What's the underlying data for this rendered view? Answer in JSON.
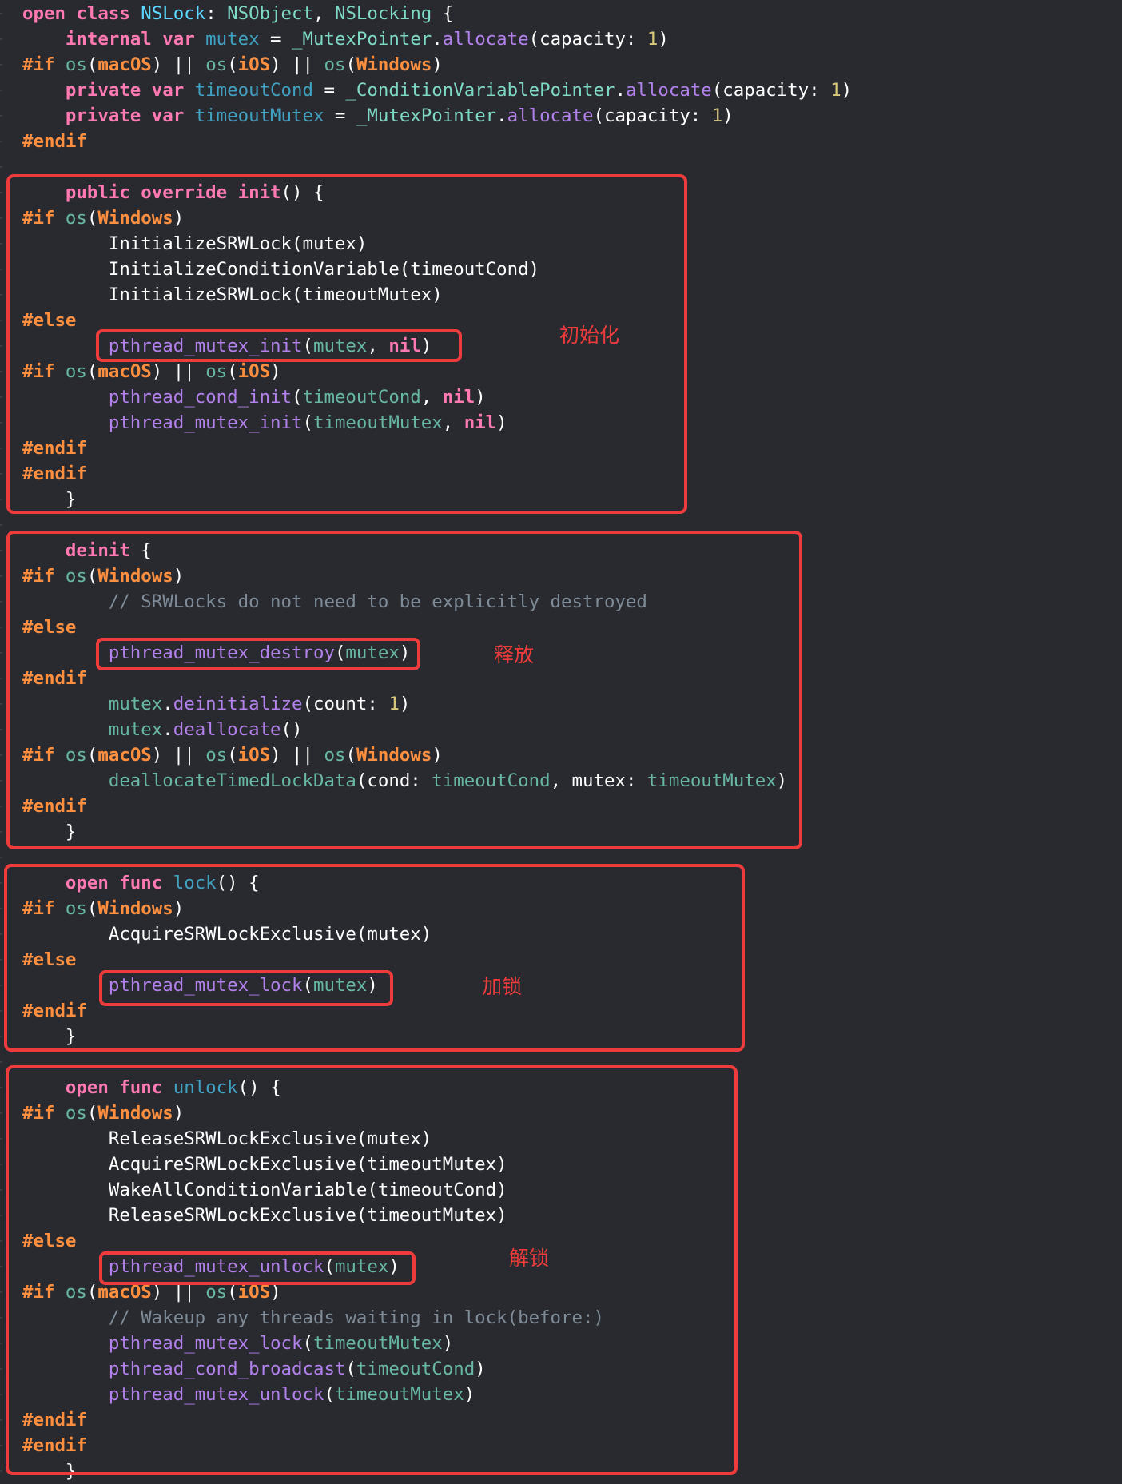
{
  "colors": {
    "background": "#292a30",
    "plain": "#ffffff",
    "keyword": "#ff7ab2",
    "preprocessor": "#fd8f3f",
    "type": "#7ed9c5",
    "type_declaration": "#5dd8ff",
    "variable": "#41a1c0",
    "reference": "#67b7a4",
    "function": "#b281eb",
    "number": "#d9c97c",
    "comment": "#7f8c98",
    "annotation": "#ee3b3b"
  },
  "code_lines": [
    [
      [
        "kw",
        "open class "
      ],
      [
        "typedecl",
        "NSLock"
      ],
      [
        "plain",
        ": "
      ],
      [
        "type",
        "NSObject"
      ],
      [
        "plain",
        ", "
      ],
      [
        "type",
        "NSLocking"
      ],
      [
        "plain",
        " {"
      ]
    ],
    [
      [
        "plain",
        "    "
      ],
      [
        "kw",
        "internal var "
      ],
      [
        "var",
        "mutex"
      ],
      [
        "plain",
        " = "
      ],
      [
        "type",
        "_MutexPointer"
      ],
      [
        "plain",
        "."
      ],
      [
        "func",
        "allocate"
      ],
      [
        "plain",
        "(capacity: "
      ],
      [
        "num",
        "1"
      ],
      [
        "plain",
        ")"
      ]
    ],
    [
      [
        "pp",
        "#if "
      ],
      [
        "ref",
        "os"
      ],
      [
        "plain",
        "("
      ],
      [
        "pp",
        "macOS"
      ],
      [
        "plain",
        ") || "
      ],
      [
        "ref",
        "os"
      ],
      [
        "plain",
        "("
      ],
      [
        "pp",
        "iOS"
      ],
      [
        "plain",
        ") || "
      ],
      [
        "ref",
        "os"
      ],
      [
        "plain",
        "("
      ],
      [
        "pp",
        "Windows"
      ],
      [
        "plain",
        ")"
      ]
    ],
    [
      [
        "plain",
        "    "
      ],
      [
        "kw",
        "private var "
      ],
      [
        "var",
        "timeoutCond"
      ],
      [
        "plain",
        " = "
      ],
      [
        "type",
        "_ConditionVariablePointer"
      ],
      [
        "plain",
        "."
      ],
      [
        "func",
        "allocate"
      ],
      [
        "plain",
        "(capacity: "
      ],
      [
        "num",
        "1"
      ],
      [
        "plain",
        ")"
      ]
    ],
    [
      [
        "plain",
        "    "
      ],
      [
        "kw",
        "private var "
      ],
      [
        "var",
        "timeoutMutex"
      ],
      [
        "plain",
        " = "
      ],
      [
        "type",
        "_MutexPointer"
      ],
      [
        "plain",
        "."
      ],
      [
        "func",
        "allocate"
      ],
      [
        "plain",
        "(capacity: "
      ],
      [
        "num",
        "1"
      ],
      [
        "plain",
        ")"
      ]
    ],
    [
      [
        "pp",
        "#endif"
      ]
    ],
    [],
    [
      [
        "plain",
        "    "
      ],
      [
        "kw",
        "public override init"
      ],
      [
        "plain",
        "() {"
      ]
    ],
    [
      [
        "pp",
        "#if "
      ],
      [
        "ref",
        "os"
      ],
      [
        "plain",
        "("
      ],
      [
        "pp",
        "Windows"
      ],
      [
        "plain",
        ")"
      ]
    ],
    [
      [
        "plain",
        "        InitializeSRWLock(mutex)"
      ]
    ],
    [
      [
        "plain",
        "        InitializeConditionVariable(timeoutCond)"
      ]
    ],
    [
      [
        "plain",
        "        InitializeSRWLock(timeoutMutex)"
      ]
    ],
    [
      [
        "pp",
        "#else"
      ]
    ],
    [
      [
        "plain",
        "        "
      ],
      [
        "func",
        "pthread_mutex_init"
      ],
      [
        "plain",
        "("
      ],
      [
        "ref",
        "mutex"
      ],
      [
        "plain",
        ", "
      ],
      [
        "kw",
        "nil"
      ],
      [
        "plain",
        ")"
      ]
    ],
    [
      [
        "pp",
        "#if "
      ],
      [
        "ref",
        "os"
      ],
      [
        "plain",
        "("
      ],
      [
        "pp",
        "macOS"
      ],
      [
        "plain",
        ") || "
      ],
      [
        "ref",
        "os"
      ],
      [
        "plain",
        "("
      ],
      [
        "pp",
        "iOS"
      ],
      [
        "plain",
        ")"
      ]
    ],
    [
      [
        "plain",
        "        "
      ],
      [
        "func",
        "pthread_cond_init"
      ],
      [
        "plain",
        "("
      ],
      [
        "ref",
        "timeoutCond"
      ],
      [
        "plain",
        ", "
      ],
      [
        "kw",
        "nil"
      ],
      [
        "plain",
        ")"
      ]
    ],
    [
      [
        "plain",
        "        "
      ],
      [
        "func",
        "pthread_mutex_init"
      ],
      [
        "plain",
        "("
      ],
      [
        "ref",
        "timeoutMutex"
      ],
      [
        "plain",
        ", "
      ],
      [
        "kw",
        "nil"
      ],
      [
        "plain",
        ")"
      ]
    ],
    [
      [
        "pp",
        "#endif"
      ]
    ],
    [
      [
        "pp",
        "#endif"
      ]
    ],
    [
      [
        "plain",
        "    }"
      ]
    ],
    [],
    [
      [
        "plain",
        "    "
      ],
      [
        "kw",
        "deinit"
      ],
      [
        "plain",
        " {"
      ]
    ],
    [
      [
        "pp",
        "#if "
      ],
      [
        "ref",
        "os"
      ],
      [
        "plain",
        "("
      ],
      [
        "pp",
        "Windows"
      ],
      [
        "plain",
        ")"
      ]
    ],
    [
      [
        "plain",
        "        "
      ],
      [
        "com",
        "// SRWLocks do not need to be explicitly destroyed"
      ]
    ],
    [
      [
        "pp",
        "#else"
      ]
    ],
    [
      [
        "plain",
        "        "
      ],
      [
        "func",
        "pthread_mutex_destroy"
      ],
      [
        "plain",
        "("
      ],
      [
        "ref",
        "mutex"
      ],
      [
        "plain",
        ")"
      ]
    ],
    [
      [
        "pp",
        "#endif"
      ]
    ],
    [
      [
        "plain",
        "        "
      ],
      [
        "ref",
        "mutex"
      ],
      [
        "plain",
        "."
      ],
      [
        "func",
        "deinitialize"
      ],
      [
        "plain",
        "(count: "
      ],
      [
        "num",
        "1"
      ],
      [
        "plain",
        ")"
      ]
    ],
    [
      [
        "plain",
        "        "
      ],
      [
        "ref",
        "mutex"
      ],
      [
        "plain",
        "."
      ],
      [
        "func",
        "deallocate"
      ],
      [
        "plain",
        "()"
      ]
    ],
    [
      [
        "pp",
        "#if "
      ],
      [
        "ref",
        "os"
      ],
      [
        "plain",
        "("
      ],
      [
        "pp",
        "macOS"
      ],
      [
        "plain",
        ") || "
      ],
      [
        "ref",
        "os"
      ],
      [
        "plain",
        "("
      ],
      [
        "pp",
        "iOS"
      ],
      [
        "plain",
        ") || "
      ],
      [
        "ref",
        "os"
      ],
      [
        "plain",
        "("
      ],
      [
        "pp",
        "Windows"
      ],
      [
        "plain",
        ")"
      ]
    ],
    [
      [
        "plain",
        "        "
      ],
      [
        "ref",
        "deallocateTimedLockData"
      ],
      [
        "plain",
        "(cond: "
      ],
      [
        "ref",
        "timeoutCond"
      ],
      [
        "plain",
        ", mutex: "
      ],
      [
        "ref",
        "timeoutMutex"
      ],
      [
        "plain",
        ")"
      ]
    ],
    [
      [
        "pp",
        "#endif"
      ]
    ],
    [
      [
        "plain",
        "    }"
      ]
    ],
    [],
    [
      [
        "plain",
        "    "
      ],
      [
        "kw",
        "open func "
      ],
      [
        "funcdecl",
        "lock"
      ],
      [
        "plain",
        "() {"
      ]
    ],
    [
      [
        "pp",
        "#if "
      ],
      [
        "ref",
        "os"
      ],
      [
        "plain",
        "("
      ],
      [
        "pp",
        "Windows"
      ],
      [
        "plain",
        ")"
      ]
    ],
    [
      [
        "plain",
        "        AcquireSRWLockExclusive(mutex)"
      ]
    ],
    [
      [
        "pp",
        "#else"
      ]
    ],
    [
      [
        "plain",
        "        "
      ],
      [
        "func",
        "pthread_mutex_lock"
      ],
      [
        "plain",
        "("
      ],
      [
        "ref",
        "mutex"
      ],
      [
        "plain",
        ")"
      ]
    ],
    [
      [
        "pp",
        "#endif"
      ]
    ],
    [
      [
        "plain",
        "    }"
      ]
    ],
    [],
    [
      [
        "plain",
        "    "
      ],
      [
        "kw",
        "open func "
      ],
      [
        "funcdecl",
        "unlock"
      ],
      [
        "plain",
        "() {"
      ]
    ],
    [
      [
        "pp",
        "#if "
      ],
      [
        "ref",
        "os"
      ],
      [
        "plain",
        "("
      ],
      [
        "pp",
        "Windows"
      ],
      [
        "plain",
        ")"
      ]
    ],
    [
      [
        "plain",
        "        ReleaseSRWLockExclusive(mutex)"
      ]
    ],
    [
      [
        "plain",
        "        AcquireSRWLockExclusive(timeoutMutex)"
      ]
    ],
    [
      [
        "plain",
        "        WakeAllConditionVariable(timeoutCond)"
      ]
    ],
    [
      [
        "plain",
        "        ReleaseSRWLockExclusive(timeoutMutex)"
      ]
    ],
    [
      [
        "pp",
        "#else"
      ]
    ],
    [
      [
        "plain",
        "        "
      ],
      [
        "func",
        "pthread_mutex_unlock"
      ],
      [
        "plain",
        "("
      ],
      [
        "ref",
        "mutex"
      ],
      [
        "plain",
        ")"
      ]
    ],
    [
      [
        "pp",
        "#if "
      ],
      [
        "ref",
        "os"
      ],
      [
        "plain",
        "("
      ],
      [
        "pp",
        "macOS"
      ],
      [
        "plain",
        ") || "
      ],
      [
        "ref",
        "os"
      ],
      [
        "plain",
        "("
      ],
      [
        "pp",
        "iOS"
      ],
      [
        "plain",
        ")"
      ]
    ],
    [
      [
        "plain",
        "        "
      ],
      [
        "com",
        "// Wakeup any threads waiting in lock(before:)"
      ]
    ],
    [
      [
        "plain",
        "        "
      ],
      [
        "func",
        "pthread_mutex_lock"
      ],
      [
        "plain",
        "("
      ],
      [
        "ref",
        "timeoutMutex"
      ],
      [
        "plain",
        ")"
      ]
    ],
    [
      [
        "plain",
        "        "
      ],
      [
        "func",
        "pthread_cond_broadcast"
      ],
      [
        "plain",
        "("
      ],
      [
        "ref",
        "timeoutCond"
      ],
      [
        "plain",
        ")"
      ]
    ],
    [
      [
        "plain",
        "        "
      ],
      [
        "func",
        "pthread_mutex_unlock"
      ],
      [
        "plain",
        "("
      ],
      [
        "ref",
        "timeoutMutex"
      ],
      [
        "plain",
        ")"
      ]
    ],
    [
      [
        "pp",
        "#endif"
      ]
    ],
    [
      [
        "pp",
        "#endif"
      ]
    ],
    [
      [
        "plain",
        "    }"
      ]
    ]
  ],
  "annotations": {
    "init": "初始化",
    "deinit": "释放",
    "lock": "加锁",
    "unlock": "解锁"
  }
}
